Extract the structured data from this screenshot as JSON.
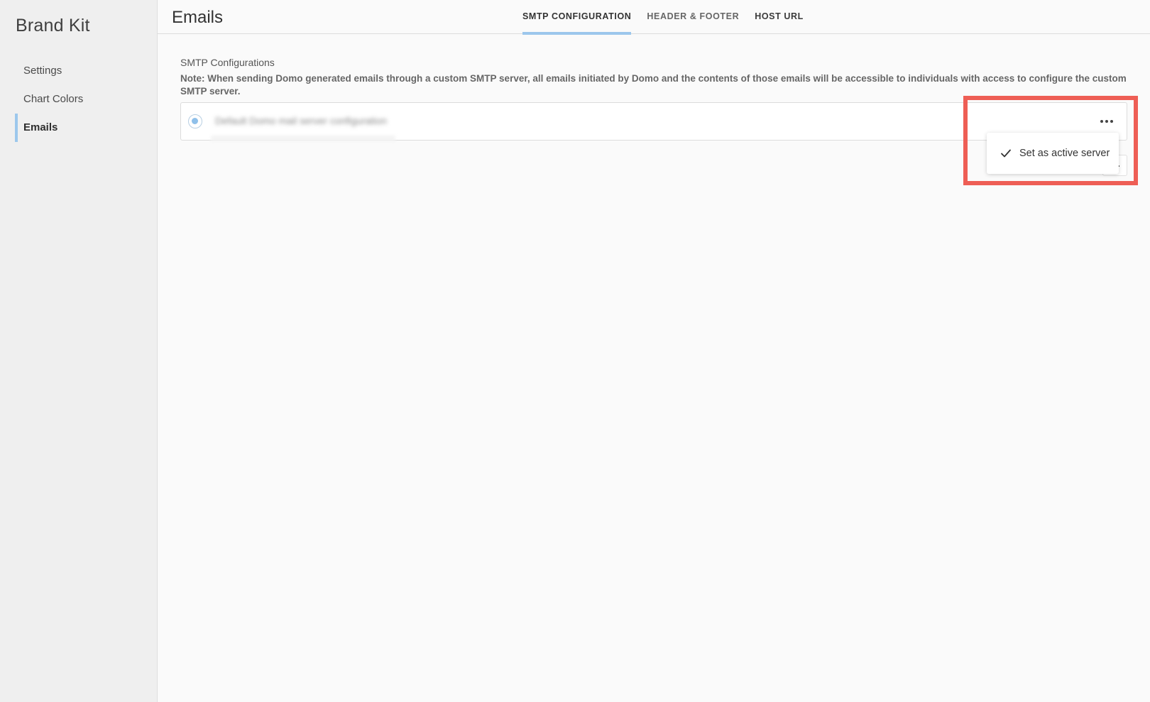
{
  "sidebar": {
    "title": "Brand Kit",
    "items": [
      {
        "label": "Settings",
        "active": false
      },
      {
        "label": "Chart Colors",
        "active": false
      },
      {
        "label": "Emails",
        "active": true
      }
    ]
  },
  "header": {
    "title": "Emails",
    "tabs": [
      {
        "label": "SMTP CONFIGURATION",
        "active": true
      },
      {
        "label": "HEADER & FOOTER",
        "active": false
      },
      {
        "label": "HOST URL",
        "active": false
      }
    ]
  },
  "main": {
    "section_title": "SMTP Configurations",
    "note": "Note: When sending Domo generated emails through a custom SMTP server, all emails initiated by Domo and the contents of those emails will be accessible to individuals with access to configure the custom SMTP server.",
    "config": {
      "name": "Default Domo mail server configuration",
      "selected": true
    }
  },
  "dropdown": {
    "items": [
      {
        "label": "Set as active server",
        "icon": "check-icon"
      }
    ]
  },
  "colors": {
    "accent": "#9cc7ec",
    "highlight": "#ee5e55"
  }
}
